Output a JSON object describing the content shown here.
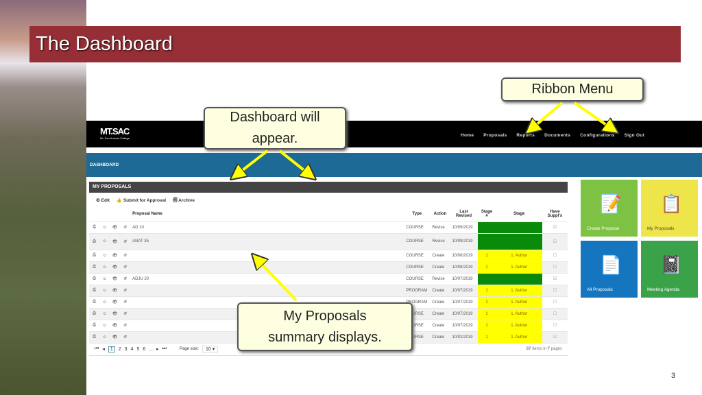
{
  "slide": {
    "title": "The Dashboard",
    "page_number": "3"
  },
  "callouts": {
    "ribbon": "Ribbon Menu",
    "dashboard": "Dashboard will appear.",
    "proposals": "My Proposals summary displays."
  },
  "app": {
    "logo": "MT.SAC",
    "logo_sub": "Mt. San Antonio College",
    "nav": [
      "Home",
      "Proposals",
      "Reports",
      "Documents",
      "Configurations",
      "Sign Out"
    ],
    "section": "DASHBOARD",
    "panel_title": "MY PROPOSALS",
    "toolbar": {
      "edit": "Edit",
      "submit": "Submit for Approval",
      "archive": "Archive"
    },
    "columns": [
      "Proposal Name",
      "Type",
      "Action",
      "Last Revised",
      "Stage #",
      "Stage",
      "Have Suppl's"
    ],
    "rows": [
      {
        "name": "AD 10",
        "type": "COURSE",
        "action": "Revise",
        "revised": "10/09/2019",
        "stage_no": "",
        "stage": "",
        "color": "green",
        "suppl": true
      },
      {
        "name": "ANAT 35",
        "type": "COURSE",
        "action": "Revise",
        "revised": "10/09/2019",
        "stage_no": "",
        "stage": "",
        "color": "green",
        "suppl": true
      },
      {
        "name": "",
        "type": "COURSE",
        "action": "Create",
        "revised": "10/08/2019",
        "stage_no": "1",
        "stage": "1. Author",
        "color": "yellow",
        "suppl": false
      },
      {
        "name": "",
        "type": "COURSE",
        "action": "Create",
        "revised": "10/08/2019",
        "stage_no": "1",
        "stage": "1. Author",
        "color": "yellow",
        "suppl": false
      },
      {
        "name": "ADJU 20",
        "type": "COURSE",
        "action": "Revise",
        "revised": "10/07/2019",
        "stage_no": "",
        "stage": "",
        "color": "green",
        "suppl": true
      },
      {
        "name": "",
        "type": "PROGRAM",
        "action": "Create",
        "revised": "10/07/2019",
        "stage_no": "1",
        "stage": "1. Author",
        "color": "yellow",
        "suppl": false
      },
      {
        "name": "",
        "type": "PROGRAM",
        "action": "Create",
        "revised": "10/07/2019",
        "stage_no": "1",
        "stage": "1. Author",
        "color": "yellow",
        "suppl": false
      },
      {
        "name": "",
        "type": "COURSE",
        "action": "Create",
        "revised": "10/07/2019",
        "stage_no": "1",
        "stage": "1. Author",
        "color": "yellow",
        "suppl": false
      },
      {
        "name": "",
        "type": "COURSE",
        "action": "Create",
        "revised": "10/07/2019",
        "stage_no": "1",
        "stage": "1. Author",
        "color": "yellow",
        "suppl": false
      },
      {
        "name": "",
        "type": "COURSE",
        "action": "Create",
        "revised": "10/02/2019",
        "stage_no": "1",
        "stage": "1. Author",
        "color": "yellow",
        "suppl": true
      }
    ],
    "pager": {
      "pages": [
        "1",
        "2",
        "3",
        "4",
        "5",
        "6",
        "..."
      ],
      "current": "1",
      "size_label": "Page size:",
      "size": "10",
      "items_total": "67",
      "items_mid": "items in",
      "pages_total": "7",
      "pages_word": "pages"
    },
    "tiles": [
      {
        "label": "Create Proposal",
        "color": "#7dc242",
        "icon": "edit-form-icon"
      },
      {
        "label": "My Proposals",
        "color": "#eee54a",
        "icon": "clipboard-icon"
      },
      {
        "label": "All Proposals",
        "color": "#1576bf",
        "icon": "list-document-icon"
      },
      {
        "label": "Meeting Agenda",
        "color": "#3aa34a",
        "icon": "notebook-icon"
      }
    ]
  }
}
